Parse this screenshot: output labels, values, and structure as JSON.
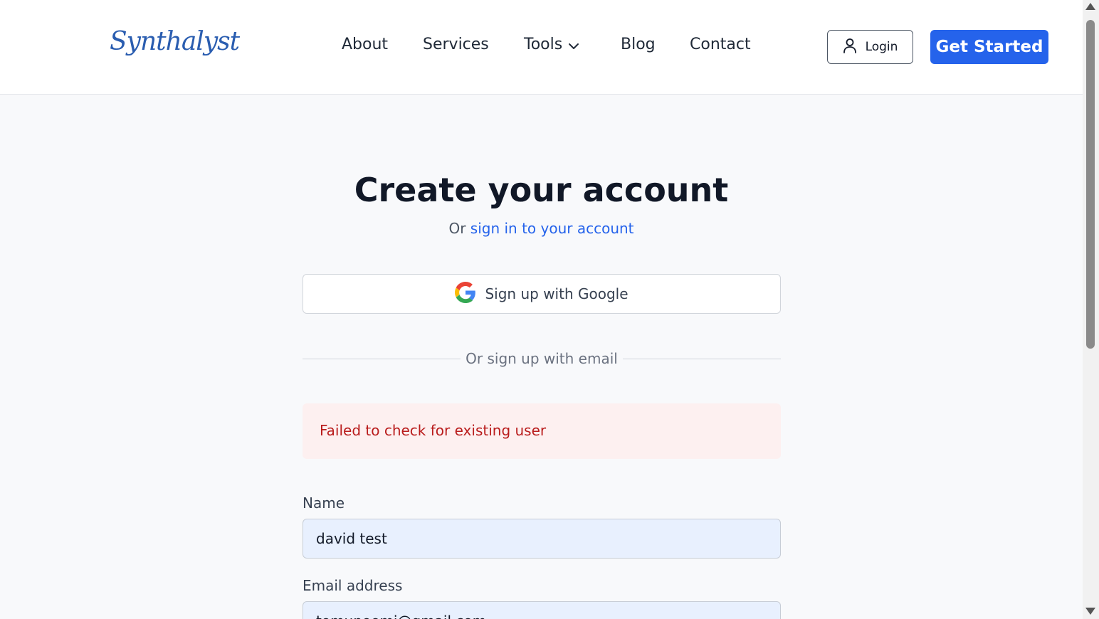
{
  "header": {
    "logo": "Synthalyst",
    "nav": [
      {
        "label": "About"
      },
      {
        "label": "Services"
      },
      {
        "label": "Tools"
      },
      {
        "label": "Blog"
      },
      {
        "label": "Contact"
      }
    ],
    "login_label": "Login",
    "cta_label": "Get Started"
  },
  "main": {
    "title": "Create your account",
    "subtitle_prefix": "Or",
    "subtitle_link": "sign in to your account",
    "google_label": "Sign up with Google",
    "divider_text": "Or sign up with email",
    "error_text": "Failed to check for existing user",
    "form": {
      "name_label": "Name",
      "name_value": "david test",
      "email_label": "Email address",
      "email_value": "tomunoemi@gmail.com"
    }
  },
  "colors": {
    "primary": "#2563eb",
    "error_bg": "#fdf0f0",
    "error_text": "#b91c1c",
    "input_bg": "#e8f0fe"
  },
  "icons": [
    "user-icon",
    "chevron-down-icon",
    "google-icon"
  ]
}
